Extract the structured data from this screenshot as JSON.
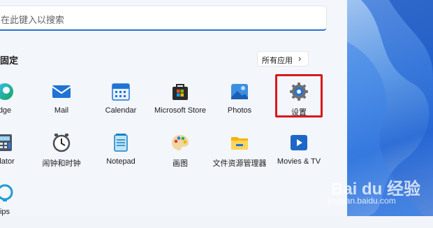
{
  "search": {
    "placeholder": "在此键入以搜索"
  },
  "pinned": {
    "title": "固定",
    "all_apps_label": "所有应用",
    "all_apps_chevron": "›"
  },
  "apps": {
    "edge": "dge",
    "mail": "Mail",
    "calendar": "Calendar",
    "store": "Microsoft Store",
    "photos": "Photos",
    "settings": "设置",
    "calculator": "ulator",
    "clock": "闹钟和时钟",
    "notepad": "Notepad",
    "paint": "画图",
    "explorer": "文件资源管理器",
    "movies": "Movies & TV",
    "tips": "ips"
  },
  "watermark": {
    "brand": "Bai du 经验",
    "url": "jingyan.baidu.com"
  },
  "colors": {
    "highlight": "#d7191e",
    "accent": "#2b6fd6"
  }
}
